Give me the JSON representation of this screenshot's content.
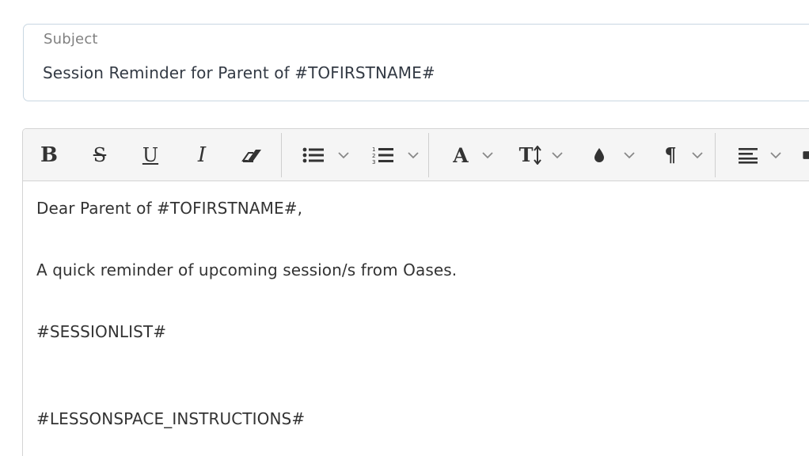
{
  "subject": {
    "label": "Subject",
    "value": "Session Reminder for Parent of #TOFIRSTNAME#"
  },
  "toolbar": {
    "bold": "B",
    "strike": "S",
    "underline": "U",
    "italic": "I",
    "font_color": "A",
    "font_size": "T",
    "paragraph": "¶",
    "icons": [
      "bold-icon",
      "strikethrough-icon",
      "underline-icon",
      "italic-icon",
      "eraser-icon",
      "bullet-list-icon",
      "numbered-list-icon",
      "font-color-icon",
      "font-size-icon",
      "ink-drop-icon",
      "paragraph-icon",
      "align-left-icon"
    ]
  },
  "body": {
    "lines": [
      "Dear Parent of #TOFIRSTNAME#,",
      "A quick reminder of upcoming session/s from Oases.",
      "#SESSIONLIST#",
      "#LESSONSPACE_INSTRUCTIONS#"
    ]
  },
  "colors": {
    "subject_border": "#c9d7e2",
    "toolbar_bg": "#f5f5f5",
    "text": "#333333",
    "label": "#808080"
  }
}
